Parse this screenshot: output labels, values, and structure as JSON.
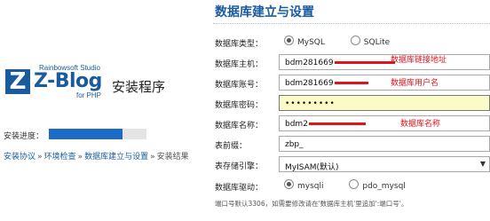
{
  "logo": {
    "mark": "Z",
    "studio": "Rainbowsoft Studio",
    "name": "Z-Blog",
    "php": "for PHP",
    "installer_title": "安装程序"
  },
  "progress": {
    "label": "安装进度：",
    "percent": 75
  },
  "breadcrumb": {
    "steps": [
      "安装协议",
      "环境检查",
      "数据库建立与设置",
      "安装结果"
    ],
    "separator": "»"
  },
  "page_title": "数据库建立与设置",
  "form": {
    "db_type": {
      "label": "数据库类型：",
      "options": [
        "MySQL",
        "SQLite"
      ],
      "selected": "MySQL"
    },
    "db_host": {
      "label": "数据库主机：",
      "value": "bdm281669",
      "annotation": "数据库链接地址"
    },
    "db_user": {
      "label": "数据库账号：",
      "value": "bdm281669",
      "annotation": "数据库用户名"
    },
    "db_password": {
      "label": "数据库密码：",
      "value": "•••••••••"
    },
    "db_name": {
      "label": "数据库名称：",
      "value": "bdm2",
      "annotation": "数据库名称"
    },
    "table_prefix": {
      "label": "表前缀：",
      "value": "zbp_"
    },
    "storage_engine": {
      "label": "表存储引擎：",
      "value": "MyISAM(默认)"
    },
    "db_driver": {
      "label": "数据库驱动：",
      "options": [
        "mysqli",
        "pdo_mysql"
      ],
      "selected": "mysqli"
    }
  },
  "note": "端口号默认3306，如需要修改请在'数据库主机'里追加':端口号'。",
  "colors": {
    "brand_blue": "#1a5b9e",
    "progress_blue": "#1b6bc7",
    "annotation_red": "#e3131b",
    "password_bg": "#fbfbc8"
  }
}
